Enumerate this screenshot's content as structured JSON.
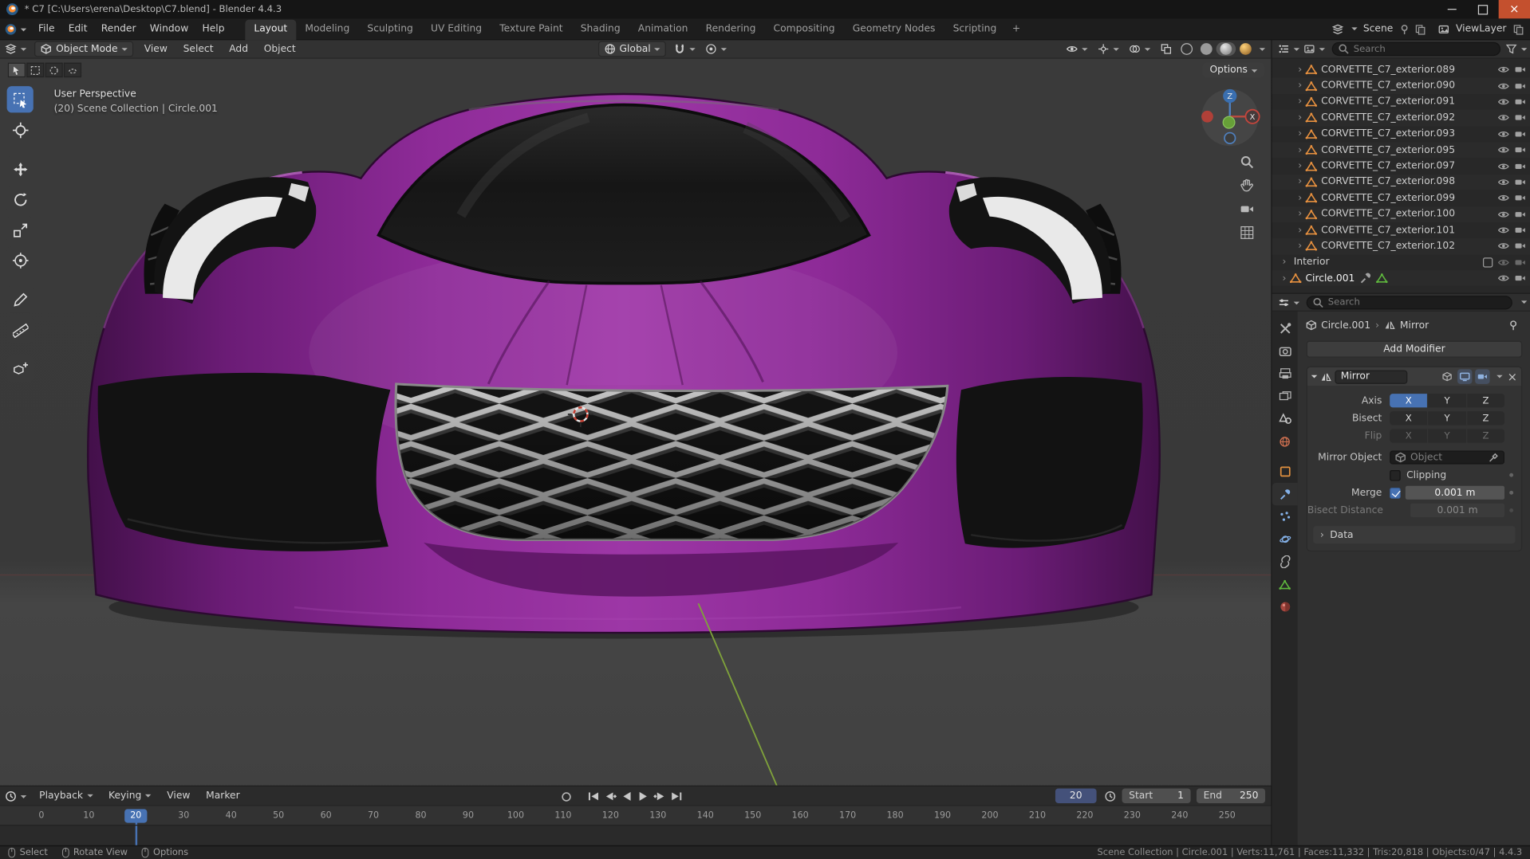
{
  "window": {
    "title": "* C7 [C:\\Users\\erena\\Desktop\\C7.blend] - Blender 4.4.3"
  },
  "topbar": {
    "menus": [
      "File",
      "Edit",
      "Render",
      "Window",
      "Help"
    ],
    "workspaces": [
      {
        "label": "Layout",
        "active": true
      },
      {
        "label": "Modeling",
        "active": false
      },
      {
        "label": "Sculpting",
        "active": false
      },
      {
        "label": "UV Editing",
        "active": false
      },
      {
        "label": "Texture Paint",
        "active": false
      },
      {
        "label": "Shading",
        "active": false
      },
      {
        "label": "Animation",
        "active": false
      },
      {
        "label": "Rendering",
        "active": false
      },
      {
        "label": "Compositing",
        "active": false
      },
      {
        "label": "Geometry Nodes",
        "active": false
      },
      {
        "label": "Scripting",
        "active": false
      }
    ],
    "add_workspace_label": "+",
    "scene_label": "Scene",
    "viewlayer_label": "ViewLayer"
  },
  "viewport_header": {
    "mode": "Object Mode",
    "menus": [
      "View",
      "Select",
      "Add",
      "Object"
    ],
    "orientation": "Global",
    "options_label": "Options"
  },
  "viewport": {
    "perspective_label": "User Perspective",
    "context_label": "(20) Scene Collection | Circle.001",
    "gizmo": {
      "x": "X",
      "z": "Z"
    }
  },
  "outliner": {
    "search_placeholder": "Search",
    "items": [
      "CORVETTE_C7_exterior.089",
      "CORVETTE_C7_exterior.090",
      "CORVETTE_C7_exterior.091",
      "CORVETTE_C7_exterior.092",
      "CORVETTE_C7_exterior.093",
      "CORVETTE_C7_exterior.095",
      "CORVETTE_C7_exterior.097",
      "CORVETTE_C7_exterior.098",
      "CORVETTE_C7_exterior.099",
      "CORVETTE_C7_exterior.100",
      "CORVETTE_C7_exterior.101",
      "CORVETTE_C7_exterior.102"
    ],
    "interior_label": "Interior",
    "object_label": "Circle.001"
  },
  "properties": {
    "search_placeholder": "Search",
    "breadcrumb": {
      "object": "Circle.001",
      "modifier": "Mirror"
    },
    "add_modifier_label": "Add Modifier",
    "modifier": {
      "name": "Mirror",
      "axis_label": "Axis",
      "bisect_label": "Bisect",
      "flip_label": "Flip",
      "axis_options": [
        "X",
        "Y",
        "Z"
      ],
      "mirror_object_label": "Mirror Object",
      "object_placeholder": "Object",
      "clipping_label": "Clipping",
      "merge_label": "Merge",
      "merge_value": "0.001 m",
      "bisect_distance_label": "Bisect Distance",
      "bisect_distance_value": "0.001 m",
      "data_label": "Data"
    }
  },
  "timeline": {
    "playback_label": "Playback",
    "keying_label": "Keying",
    "view_label": "View",
    "marker_label": "Marker",
    "current_frame": "20",
    "playhead_label": "20",
    "start_label": "Start",
    "start_value": "1",
    "end_label": "End",
    "end_value": "250",
    "ticks": [
      "0",
      "10",
      "20",
      "30",
      "40",
      "50",
      "60",
      "70",
      "80",
      "90",
      "100",
      "110",
      "120",
      "130",
      "140",
      "150",
      "160",
      "170",
      "180",
      "190",
      "200",
      "210",
      "220",
      "230",
      "240",
      "250"
    ]
  },
  "statusbar": {
    "hints": [
      "Select",
      "Rotate View",
      "Options"
    ],
    "stats": "Scene Collection | Circle.001 | Verts:11,761 | Faces:11,332 | Tris:20,818 | Objects:0/47 | 4.4.3"
  }
}
